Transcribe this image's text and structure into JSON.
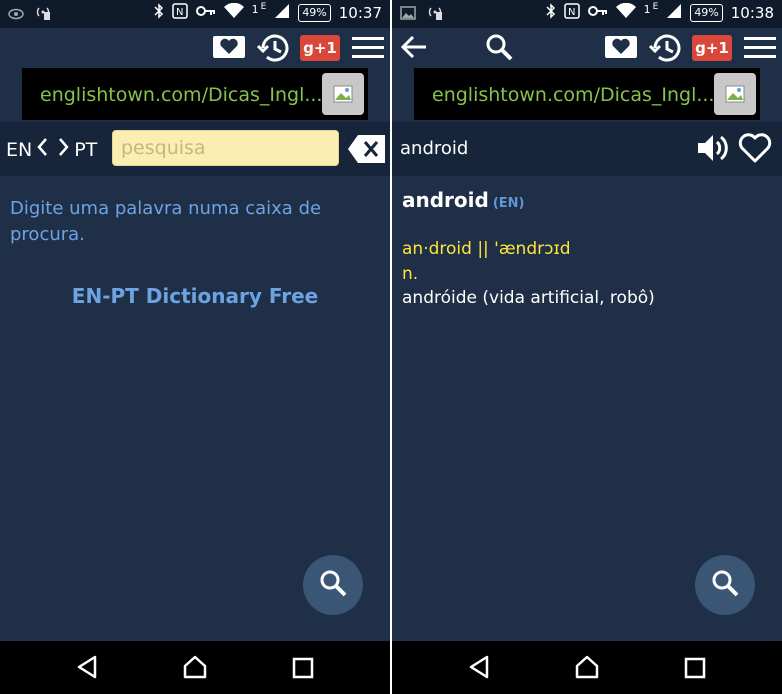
{
  "left": {
    "status": {
      "time": "10:37",
      "battery": "49%",
      "sim": "1",
      "net": "E"
    },
    "ad": {
      "text": "englishtown.com/Dicas_Ingl..."
    },
    "search": {
      "lang_from": "EN",
      "lang_to": "PT",
      "placeholder": "pesquisa"
    },
    "hint": "Digite uma palavra numa caixa de procura.",
    "app_title": "EN-PT Dictionary Free",
    "toolbar": {
      "gplus_label": "g+1"
    }
  },
  "right": {
    "status": {
      "time": "10:38",
      "battery": "49%",
      "sim": "1",
      "net": "E"
    },
    "ad": {
      "text": "englishtown.com/Dicas_Ingl..."
    },
    "word": "android",
    "entry": {
      "headword": "android",
      "lang_tag": "(EN)",
      "pronunciation": "an·droid || 'ændrɔɪd",
      "pos": "n.",
      "translation": "andróide (vida artificial, robô)"
    },
    "toolbar": {
      "gplus_label": "g+1"
    }
  },
  "colors": {
    "background": "#1e2f47",
    "accent_blue": "#6ea3e3",
    "pronunciation_yellow": "#ffe53b",
    "ad_link_green": "#86c24a",
    "search_field": "#fbeeb3",
    "gplus_red": "#d9463a"
  },
  "icons": {
    "status_left_left": [
      "eye-icon",
      "wifi-hotspot-icon"
    ],
    "status_left_right": [
      "image-icon",
      "wifi-hotspot-icon"
    ],
    "status_right": [
      "bluetooth-icon",
      "nfc-icon",
      "key-icon",
      "wifi-icon",
      "signal-icon",
      "battery-icon"
    ],
    "toolbar": [
      "favorites-heart-icon",
      "history-icon",
      "gplus-icon",
      "menu-icon",
      "back-arrow-icon",
      "search-icon"
    ],
    "nav": [
      "back-triangle-icon",
      "home-icon",
      "recents-icon"
    ]
  }
}
